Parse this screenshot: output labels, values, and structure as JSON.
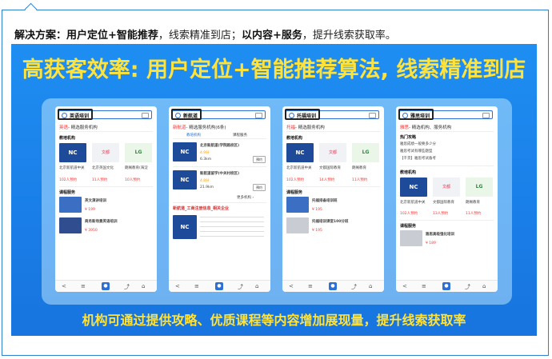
{
  "caption": {
    "label1": "解决方案：",
    "part1": "用户定位+智能推荐",
    "part2": "，线索精准到店；",
    "part3": "以内容+服务",
    "part4": "，提升线索获取率。"
  },
  "banner": {
    "headline": "高获客效率: 用户定位+智能推荐算法, 线索精准到店",
    "subline": "机构可通过提供攻略、优质课程等内容增加展现量，提升线索获取率",
    "colors": {
      "accent_yellow": "#ffe23a",
      "banner_blue": "#1e8ef2"
    }
  },
  "phones": [
    {
      "query": "英语培训",
      "title_red": "英语",
      "title_rest": "- 精选服务机构",
      "section1": "教培机构",
      "orgs": [
        "北京新航道中关",
        "北京英国文化",
        "朗阁教育(海淀"
      ],
      "counts": [
        "102人预约",
        "11人预约",
        "10人预约"
      ],
      "section2": "课程服务",
      "courses": [
        "英文演讲培训",
        "商务新场景英语培训"
      ],
      "prices": [
        "¥ 199",
        "¥ 3950"
      ],
      "nav": [
        "<",
        "≡",
        "◆",
        "⤴",
        "⌂"
      ]
    },
    {
      "query": "新航道",
      "title_red": "新航道",
      "title_rest": "- 精选服务机构(6条)",
      "tabs": [
        "教培机构",
        "课程服务"
      ],
      "orgs": [
        "北京新航道(学院路校区)",
        "新航道留学(中关村校区)"
      ],
      "ratings": [
        "4.9分",
        "4.8分"
      ],
      "dist": [
        "6.3km",
        "21.9km"
      ],
      "btn": "预约",
      "more": "更多机构 ›",
      "section2": "新航道_工商注册信息_相关企业",
      "nav": [
        "<",
        "≡",
        "◆",
        "⤴",
        "⌂"
      ]
    },
    {
      "query": "托福培训",
      "title_red": "托福",
      "title_rest": "- 精选服务机构",
      "section1": "教培机构",
      "orgs": [
        "北京新航道中关",
        "文都国际教育",
        "朗阁教育"
      ],
      "counts": [
        "102人预约",
        "14人预约",
        "11人预约"
      ],
      "section2": "课程服务",
      "courses": [
        "托福排备培训班",
        "托福培训课堂100分班"
      ],
      "prices": [
        "¥ 195",
        "¥ 195"
      ],
      "nav": [
        "<",
        "≡",
        "◆",
        "⤴",
        "⌂"
      ]
    },
    {
      "query": "雅思培训",
      "title_red": "雅思",
      "title_rest": "- 精选机构、服务机构",
      "section0": "热门攻略",
      "tips": [
        "雅思成绩一般要多少分",
        "雅思考试有哪些题型",
        "【干货】雅思考试备考"
      ],
      "section1": "教培机构",
      "orgs": [
        "北京新航道中关",
        "文都国际教育",
        "朗阁教育"
      ],
      "counts": [
        "102人预约",
        "13人预约",
        "11人预约"
      ],
      "section2": "课程服务",
      "courses": [
        "雅思高级强化培训"
      ],
      "prices": [
        "¥ 189"
      ],
      "nav": [
        "<",
        "≡",
        "◆",
        "⤴",
        "⌂"
      ]
    }
  ]
}
